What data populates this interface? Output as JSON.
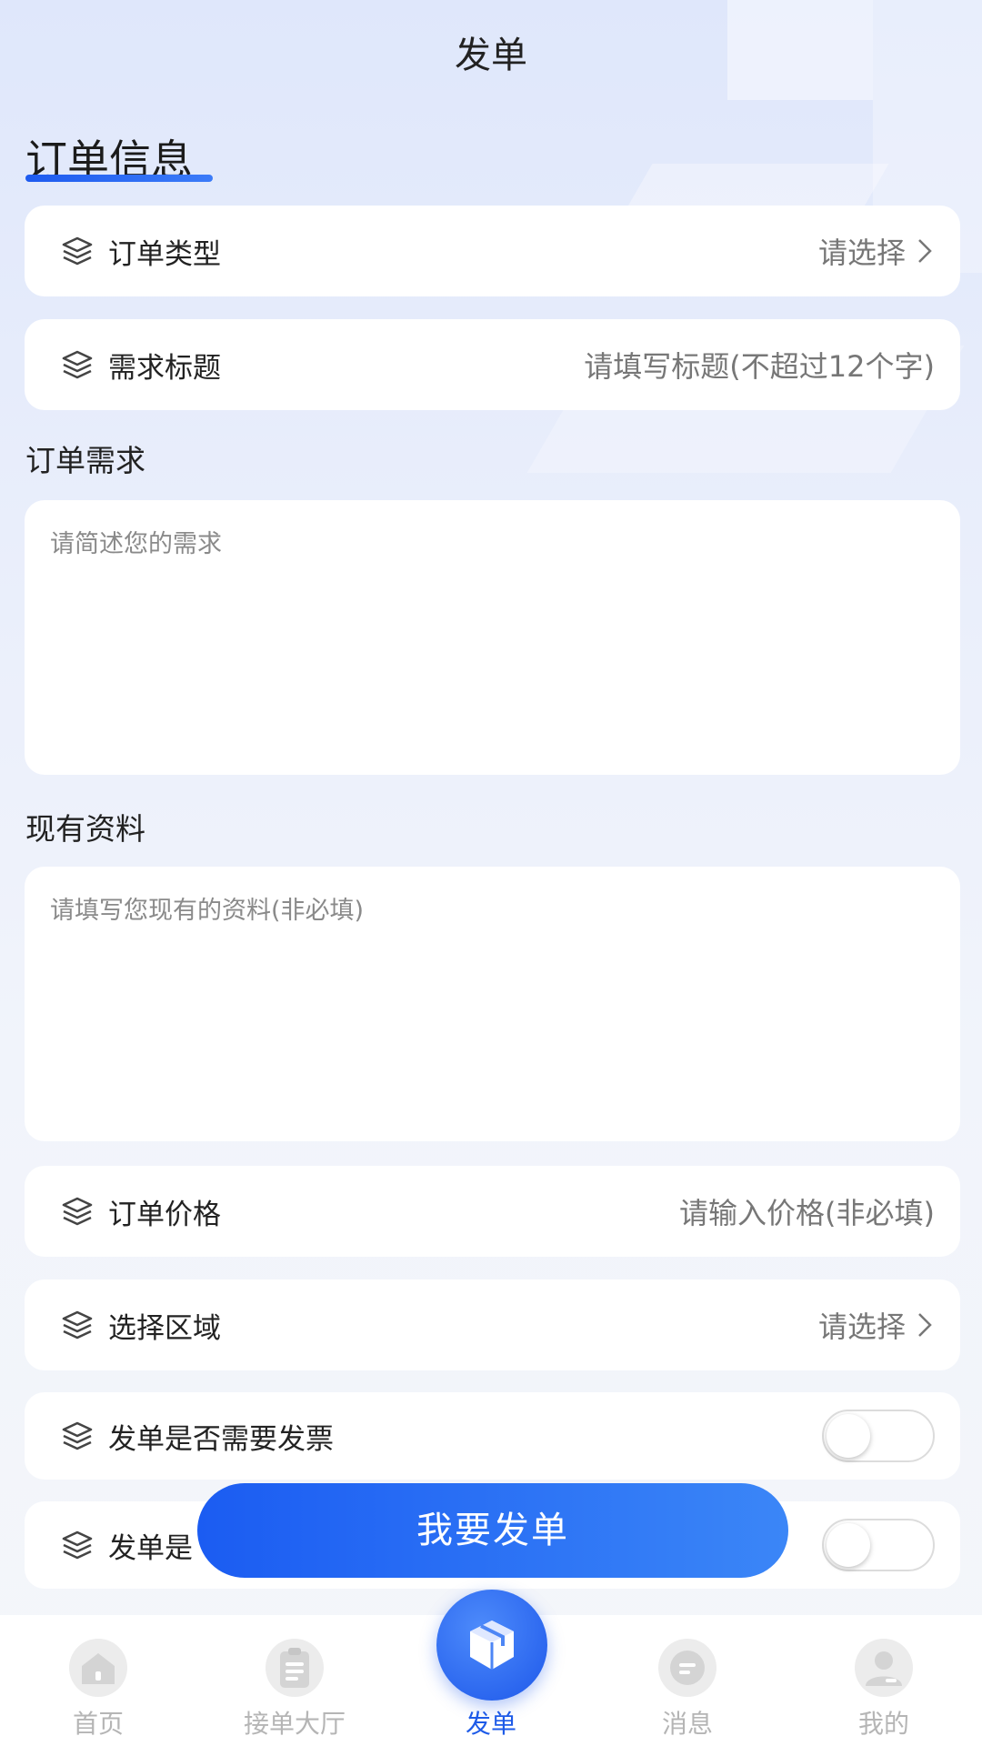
{
  "header": {
    "title": "发单"
  },
  "section": {
    "title": "订单信息"
  },
  "rows": {
    "order_type": {
      "label": "订单类型",
      "value": "请选择"
    },
    "demand_title": {
      "label": "需求标题",
      "placeholder": "请填写标题(不超过12个字)"
    },
    "price": {
      "label": "订单价格",
      "placeholder": "请输入价格(非必填)"
    },
    "region": {
      "label": "选择区域",
      "value": "请选择"
    },
    "invoice": {
      "label": "发单是否需要发票",
      "enabled": false
    },
    "second_toggle": {
      "label": "发单是",
      "enabled": false
    }
  },
  "demand": {
    "title": "订单需求",
    "placeholder": "请简述您的需求"
  },
  "materials": {
    "title": "现有资料",
    "placeholder": "请填写您现有的资料(非必填)"
  },
  "submit": {
    "label": "我要发单"
  },
  "tabbar": {
    "tabs": [
      {
        "label": "首页",
        "icon": "home-icon"
      },
      {
        "label": "接单大厅",
        "icon": "clipboard-icon"
      },
      {
        "label": "发单",
        "icon": "box-icon",
        "active": true
      },
      {
        "label": "消息",
        "icon": "message-icon"
      },
      {
        "label": "我的",
        "icon": "user-icon"
      }
    ]
  },
  "colors": {
    "accent": "#1e5be8",
    "background": "#eef2fb"
  }
}
